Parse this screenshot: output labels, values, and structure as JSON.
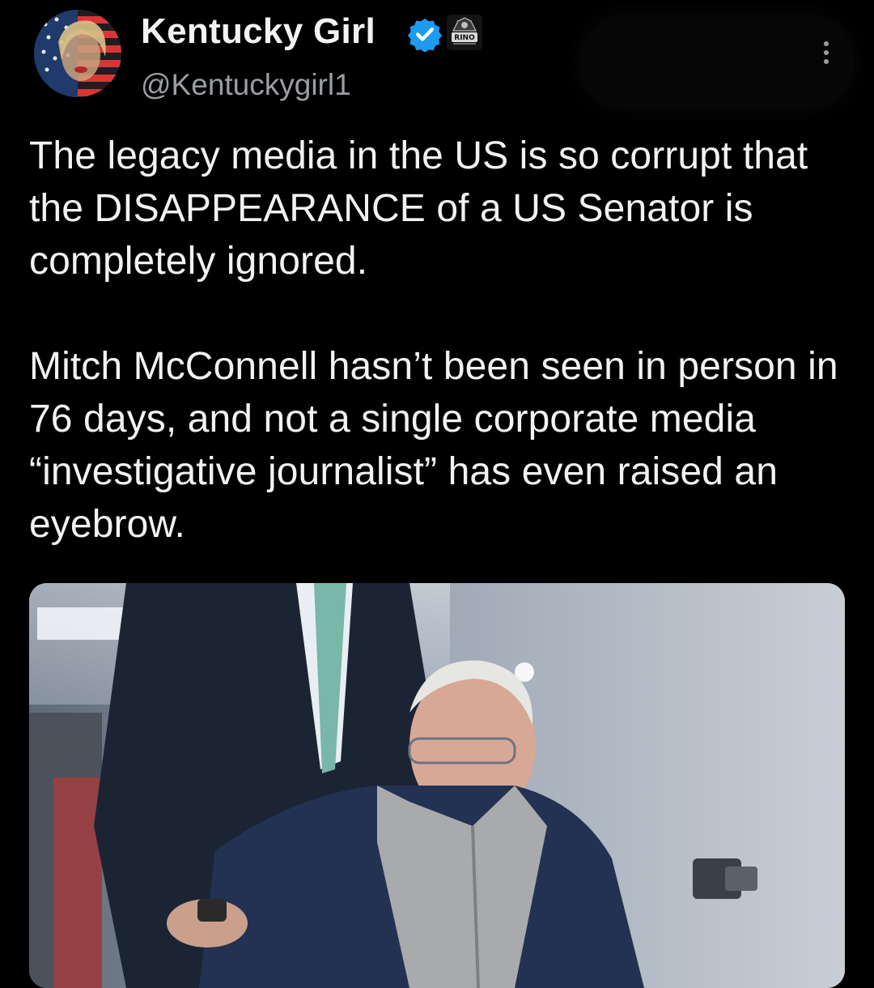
{
  "author": {
    "display_name": "Kentucky Girl",
    "handle": "@Kentuckygirl1",
    "verified": true,
    "badge_text": "RINO"
  },
  "tweet": {
    "paragraphs": [
      "The legacy media in the US is so corrupt that the DISAPPEARANCE of a US Senator is completely ignored.",
      "Mitch McConnell hasn’t been seen in person in 76 days, and not a single corporate media “investigative journalist” has even raised an eyebrow."
    ]
  },
  "colors": {
    "background": "#000000",
    "verified_blue": "#1d9bf0",
    "text_primary": "#f2f2f2",
    "text_secondary": "#9a9ea3"
  },
  "icons": {
    "verified": "verified-badge-icon",
    "more": "more-vertical-icon",
    "affiliate": "affiliate-badge-icon"
  }
}
